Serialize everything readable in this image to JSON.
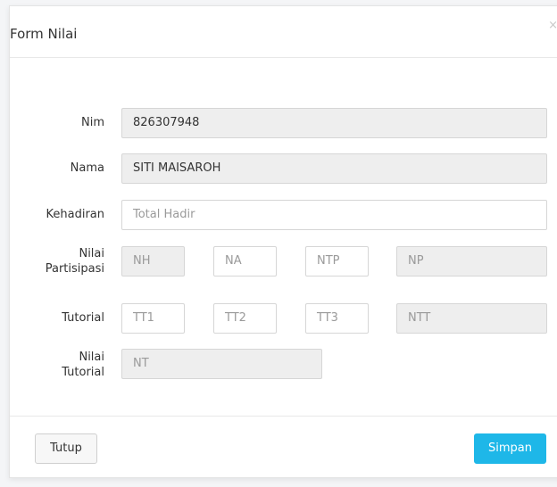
{
  "modal": {
    "title": "Form Nilai",
    "close_glyph": "×"
  },
  "form": {
    "nim": {
      "label": "Nim",
      "value": "826307948"
    },
    "nama": {
      "label": "Nama",
      "value": "SITI MAISAROH"
    },
    "kehadiran": {
      "label": "Kehadiran",
      "placeholder": "Total Hadir"
    },
    "nilai_partisipasi": {
      "label_line1": "Nilai",
      "label_line2": "Partisipasi",
      "nh": "NH",
      "na": "NA",
      "ntp": "NTP",
      "np": "NP"
    },
    "tutorial": {
      "label": "Tutorial",
      "tt1": "TT1",
      "tt2": "TT2",
      "tt3": "TT3",
      "ntt": "NTT"
    },
    "nilai_tutorial": {
      "label_line1": "Nilai",
      "label_line2": "Tutorial",
      "nt": "NT"
    }
  },
  "footer": {
    "close_label": "Tutup",
    "save_label": "Simpan"
  }
}
